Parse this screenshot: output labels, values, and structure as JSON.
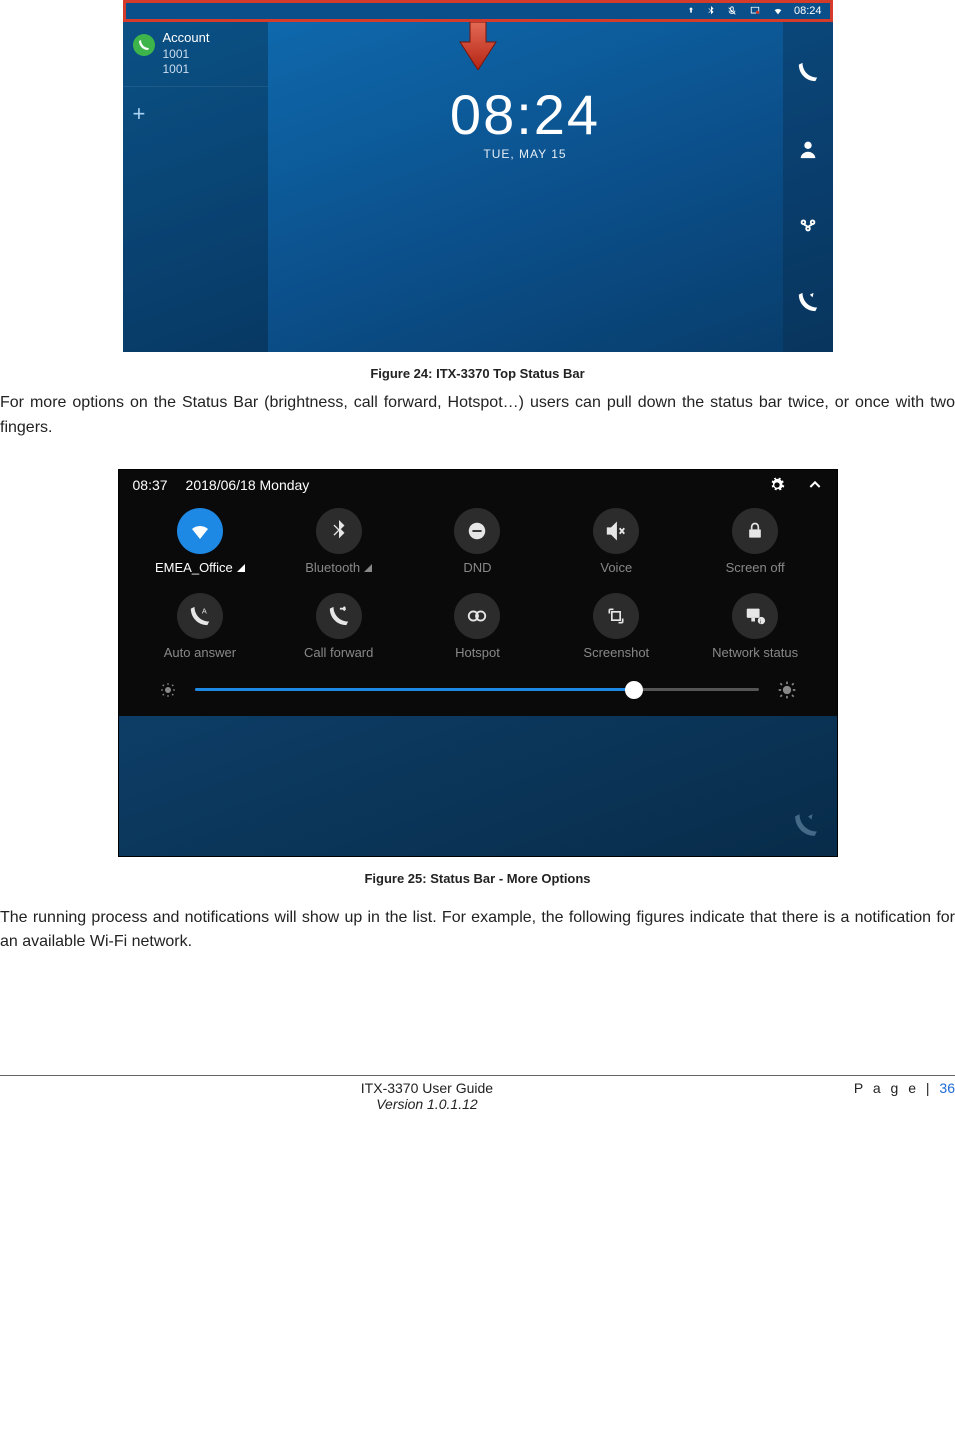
{
  "figure24": {
    "caption": "Figure 24: ITX-3370 Top Status Bar",
    "statusbar_time": "08:24",
    "account_label": "Account",
    "account_num1": "1001",
    "account_num2": "1001",
    "clock_time": "08:24",
    "clock_date": "TUE, MAY 15"
  },
  "para1": "For more options on the Status Bar (brightness, call forward, Hotspot…) users can pull down the status bar twice, or once with two fingers.",
  "figure25": {
    "caption": "Figure 25: Status Bar - More Options",
    "top_time": "08:37",
    "top_date": "2018/06/18 Monday",
    "tiles": {
      "wifi": "EMEA_Office",
      "bluetooth": "Bluetooth",
      "dnd": "DND",
      "voice": "Voice",
      "screenoff": "Screen off",
      "autoanswer": "Auto answer",
      "callforward": "Call forward",
      "hotspot": "Hotspot",
      "screenshot": "Screenshot",
      "netstatus": "Network status"
    }
  },
  "para2": "The running process and notifications will show up in the list. For example, the following figures indicate that there is a notification for an available Wi-Fi network.",
  "footer": {
    "page_label": "P a g e | ",
    "page_num": "36",
    "title": "ITX-3370 User Guide",
    "version": "Version 1.0.1.12"
  }
}
